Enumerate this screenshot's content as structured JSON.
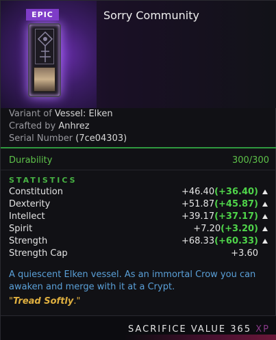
{
  "item": {
    "rarity": "EPIC",
    "title": "Sorry Community",
    "variant_label": "Variant of",
    "variant_value": "Vessel: Elken",
    "crafted_label": "Crafted by",
    "crafted_value": "Anhrez",
    "serial_label": "Serial Number",
    "serial_value": "(7ce04303)",
    "icon": "vessel-icon"
  },
  "durability": {
    "label": "Durability",
    "value": "300/300"
  },
  "statistics": {
    "header": "STATISTICS",
    "rows": [
      {
        "name": "Constitution",
        "base": "+46.40",
        "bonus": "(+36.40)",
        "arrow": true
      },
      {
        "name": "Dexterity",
        "base": "+51.87",
        "bonus": "(+45.87)",
        "arrow": true
      },
      {
        "name": "Intellect",
        "base": "+39.17",
        "bonus": "(+37.17)",
        "arrow": true
      },
      {
        "name": "Spirit",
        "base": "+7.20",
        "bonus": "(+3.20)",
        "arrow": true
      },
      {
        "name": "Strength",
        "base": "+68.33",
        "bonus": "(+60.33)",
        "arrow": true
      },
      {
        "name": "Strength Cap",
        "base": "+3.60",
        "bonus": "",
        "arrow": false
      }
    ]
  },
  "description": "A quiescent Elken vessel. As an immortal Crow you can awaken and merge with it at a Crypt.",
  "quote": {
    "open": "\"",
    "text": "Tread Softly",
    "close": ".\""
  },
  "footer": {
    "label": "SACRIFICE VALUE",
    "value": "365",
    "unit": "XP"
  },
  "colors": {
    "rarity": "#7e3cc8",
    "positive": "#4fd44a",
    "description": "#5aa0d8",
    "quote": "#e0b040",
    "separator": "#2f9a3f"
  }
}
